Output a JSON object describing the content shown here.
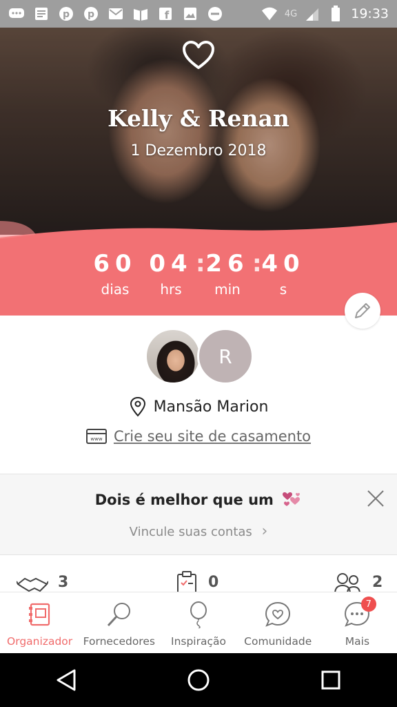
{
  "status_bar": {
    "time": "19:33",
    "network": "4G",
    "icons": [
      "chat-icon",
      "news-icon",
      "pinterest-icon",
      "pinterest-icon",
      "gmail-icon",
      "books-icon",
      "facebook-icon",
      "photos-icon",
      "do-not-disturb-icon",
      "wifi-icon",
      "signal-icon",
      "battery-icon"
    ]
  },
  "hero": {
    "names": "Kelly & Renan",
    "date": "1 Dezembro 2018"
  },
  "countdown": {
    "days": "60",
    "days_label": "dias",
    "hours": "04",
    "hours_label": "hrs",
    "minutes": "26",
    "minutes_label": "min",
    "seconds": "40",
    "seconds_label": "s",
    "separator": ":"
  },
  "profile": {
    "partner_initial": "R",
    "venue": "Mansão Marion",
    "site_link": "Crie seu site de casamento"
  },
  "banner": {
    "title": "Dois é melhor que um",
    "subtitle": "Vincule suas contas",
    "subtitle_chevron": "›"
  },
  "stats": [
    {
      "icon": "handshake-icon",
      "count": "3"
    },
    {
      "icon": "checklist-icon",
      "count": "0"
    },
    {
      "icon": "guests-icon",
      "count": "2"
    }
  ],
  "bottom_nav": {
    "items": [
      {
        "label": "Organizador",
        "icon": "organizer-icon",
        "active": true
      },
      {
        "label": "Fornecedores",
        "icon": "search-icon",
        "active": false
      },
      {
        "label": "Inspiração",
        "icon": "balloon-icon",
        "active": false
      },
      {
        "label": "Comunidade",
        "icon": "heart-chat-icon",
        "active": false
      },
      {
        "label": "Mais",
        "icon": "more-icon",
        "active": false,
        "badge": "7"
      }
    ]
  },
  "colors": {
    "accent": "#f06b6b",
    "countdown_bg": "#f27174",
    "badge": "#ef4f4f"
  }
}
